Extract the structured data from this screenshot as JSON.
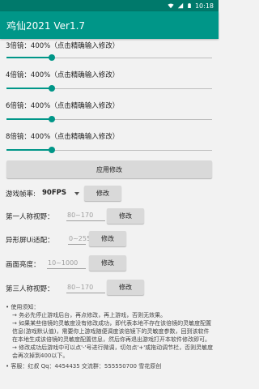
{
  "status": {
    "time": "10:18"
  },
  "appbar": {
    "title": "鸡仙2021 Ver1.7"
  },
  "zooms": [
    {
      "label": "3倍镜：400%（点击精确输入修改）"
    },
    {
      "label": "4倍镜：400%（点击精确输入修改）"
    },
    {
      "label": "6倍镜：400%（点击精确输入修改）"
    },
    {
      "label": "8倍镜：400%（点击精确输入修改）"
    }
  ],
  "slider_levels_percent": [
    400,
    400,
    400,
    400
  ],
  "apply_button": "应用修改",
  "framerate": {
    "label": "游戏帧率:",
    "value": "90FPS",
    "button": "修改"
  },
  "fov_first": {
    "label": "第一人称视野：",
    "placeholder": "80~170",
    "button": "修改"
  },
  "ui_adapt": {
    "label": "异形屏Ui适配：",
    "placeholder": "0~255",
    "button": "修改"
  },
  "brightness": {
    "label": "画面亮度：",
    "placeholder": "10~1000",
    "button": "修改"
  },
  "fov_third": {
    "label": "第三人称视野：",
    "placeholder": "80~170",
    "button": "修改"
  },
  "notes": {
    "heading": "• 使用须知：",
    "items": [
      "→ 务必先停止游戏后台，再点修改，再上游戏，否则无效果。",
      "→ 如果某些倍镜的灵敏度没有修改成功，即代表本地不存在该倍镜的灵敏度配置信息(游戏默认值)，需要你上游戏随便调度该倍镜下的灵敏度参数，回到该软件在本地生成该倍镜的灵敏度配置信息，然后你再退出游戏打开本软件修改即可。",
      "→ 修改成功后游戏中可以点'-'号进行微调，切勿点'+'或拖动调节栏，否则灵敏度会再次掉到400以下。"
    ],
    "footer": "• 客服：红叔 Qq：4454435 交流群：555550700 雪花原创"
  }
}
